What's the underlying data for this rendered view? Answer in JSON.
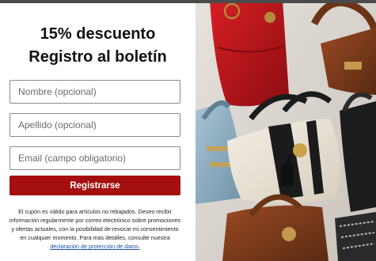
{
  "popup": {
    "title_line1": "15% descuento",
    "title_line2": "Registro al boletín",
    "fields": {
      "name_placeholder": "Nombre (opcional)",
      "surname_placeholder": "Apellido (opcional)",
      "email_placeholder": "Email (campo obligatorio)"
    },
    "submit_label": "Registrarse",
    "disclaimer_text": "El cupón es válido para artículos no rebajados. Deseo recibir información regularmente por correo electrónico sobre promociones y ofertas actuales, con la posibilidad de revocar mi consentimiento en cualquier momento. Para más detalles, consulte nuestra",
    "privacy_link": "declaración de protección de datos."
  },
  "image": {
    "icon": "handbags-photo",
    "colors": {
      "background": "#d9d5cf",
      "red_bag": "#c0151d",
      "brown_bag": "#7a3b1e",
      "blue_bag": "#8fb0c4",
      "cream_bag": "#e9e2d4",
      "black_stripe": "#1b1b1b"
    }
  },
  "theme": {
    "accent": "#a50f0f",
    "link": "#1a4fa3"
  }
}
